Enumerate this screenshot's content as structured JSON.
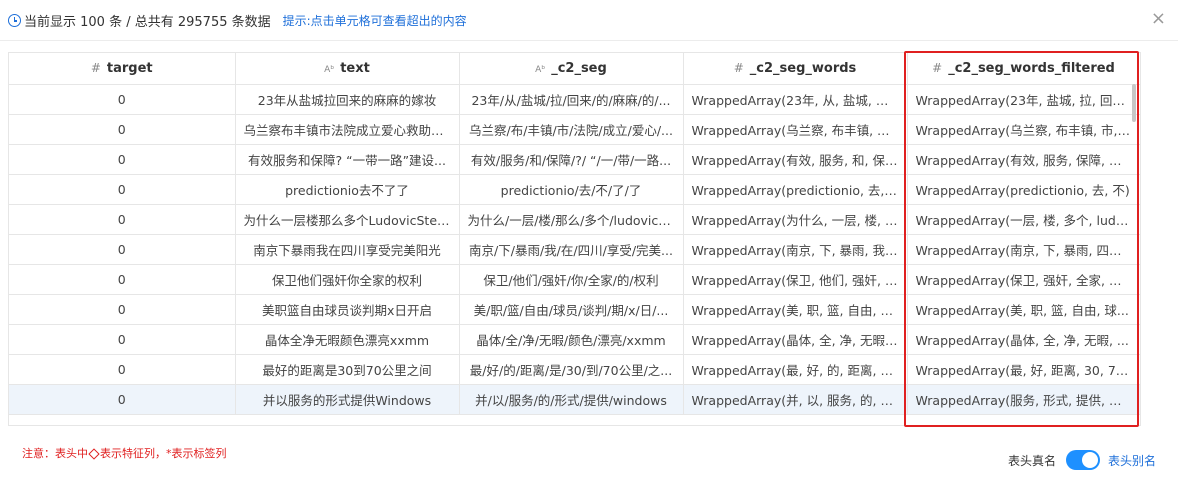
{
  "header": {
    "summary": "当前显示 100 条 / 总共有 295755 条数据",
    "hint": "提示:点击单元格可查看超出的内容",
    "close_glyph": "×"
  },
  "table": {
    "columns": [
      {
        "icon": "#",
        "name": "target"
      },
      {
        "icon": "Aᵇ",
        "name": "text"
      },
      {
        "icon": "Aᵇ",
        "name": "_c2_seg"
      },
      {
        "icon": "#",
        "name": "_c2_seg_words"
      },
      {
        "icon": "#",
        "name": "_c2_seg_words_filtered"
      }
    ],
    "rows": [
      [
        "0",
        "23年从盐城拉回来的麻麻的嫁妆",
        "23年/从/盐城/拉/回来/的/麻麻/的/...",
        "WrappedArray(23年, 从, 盐城, 拉, ...",
        "WrappedArray(23年, 盐城, 拉, 回来..."
      ],
      [
        "0",
        "乌兰察布丰镇市法院成立爱心救助基...",
        "乌兰察/布/丰镇/市/法院/成立/爱心/...",
        "WrappedArray(乌兰察, 布丰镇, 市, ...",
        "WrappedArray(乌兰察, 布丰镇, 市, ..."
      ],
      [
        "0",
        "有效服务和保障? “一带一路”建设...",
        "有效/服务/和/保障/?/ “/一/带/一路...",
        "WrappedArray(有效, 服务, 和, 保障...",
        "WrappedArray(有效, 服务, 保障, 带..."
      ],
      [
        "0",
        "predictionio去不了了",
        "predictionio/去/不/了/了",
        "WrappedArray(predictionio, 去, ...",
        "WrappedArray(predictionio, 去, 不)"
      ],
      [
        "0",
        "为什么一层楼那么多个LudovicStep...",
        "为什么/一层/楼/那么/多个/ludovics...",
        "WrappedArray(为什么, 一层, 楼, 那...",
        "WrappedArray(一层, 楼, 多个, ludo..."
      ],
      [
        "0",
        "南京下暴雨我在四川享受完美阳光",
        "南京/下/暴雨/我/在/四川/享受/完美...",
        "WrappedArray(南京, 下, 暴雨, 我, ...",
        "WrappedArray(南京, 下, 暴雨, 四川..."
      ],
      [
        "0",
        "保卫他们强奸你全家的权利",
        "保卫/他们/强奸/你/全家/的/权利",
        "WrappedArray(保卫, 他们, 强奸, 你...",
        "WrappedArray(保卫, 强奸, 全家, 权..."
      ],
      [
        "0",
        "美职篮自由球员谈判期x日开启",
        "美/职/篮/自由/球员/谈判/期/x/日/...",
        "WrappedArray(美, 职, 篮, 自由, 球...",
        "WrappedArray(美, 职, 篮, 自由, 球..."
      ],
      [
        "0",
        "晶体全净无暇颜色漂亮xxmm",
        "晶体/全/净/无暇/颜色/漂亮/xxmm",
        "WrappedArray(晶体, 全, 净, 无暇, ...",
        "WrappedArray(晶体, 全, 净, 无暇, ..."
      ],
      [
        "0",
        "最好的距离是30到70公里之间",
        "最/好/的/距离/是/30/到/70公里/之...",
        "WrappedArray(最, 好, 的, 距离, 是, ...",
        "WrappedArray(最, 好, 距离, 30, 70..."
      ],
      [
        "0",
        "并以服务的形式提供Windows",
        "并/以/服务/的/形式/提供/windows",
        "WrappedArray(并, 以, 服务, 的, 形...",
        "WrappedArray(服务, 形式, 提供, wi..."
      ]
    ]
  },
  "footer": {
    "note_prefix": "注意：表头中",
    "note_suffix": "表示特征列，*表示标签列",
    "toggle_left": "表头真名",
    "toggle_right": "表头别名",
    "toggle_on": true
  },
  "colors": {
    "accent": "#1e6fd9",
    "warning": "#e02020",
    "row_highlight": "#eef4fb"
  }
}
